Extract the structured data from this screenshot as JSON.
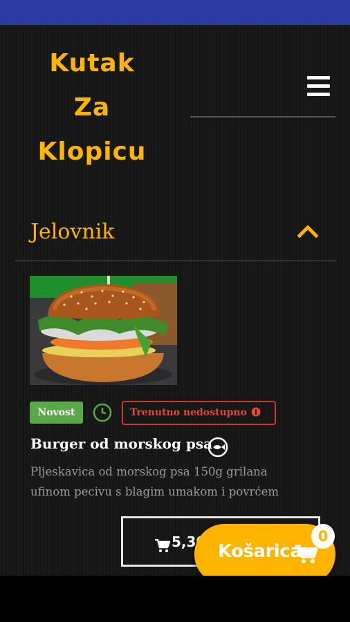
{
  "header": {
    "logo_lines": [
      "Kutak",
      "Za",
      "Klopicu"
    ],
    "menu_icon": "hamburger-menu-icon"
  },
  "menu_section": {
    "title": "Jelovnik",
    "toggle_icon": "chevron-up-icon"
  },
  "product": {
    "image_alt": "burger-photo",
    "badge_new": "Novost",
    "clock_icon": "clock-icon",
    "availability": "Trenutno nedostupno",
    "info_icon": "info-icon",
    "name": "Burger od morskog psa",
    "category_icon": "fish-icon",
    "description_lines": [
      "Pljeskavica od morskog psa 150g grilana",
      "ufinom pecivu s blagim umakom i povrćem"
    ],
    "price": "5,30"
  },
  "cart": {
    "label": "Košarica",
    "count": "0",
    "icon": "shopping-cart-icon"
  },
  "colors": {
    "accent": "#ffb400",
    "background": "#171717",
    "status_bar": "#2c3aa5",
    "badge_green": "#5aa84a",
    "unavailable_red": "#c83b2e"
  }
}
